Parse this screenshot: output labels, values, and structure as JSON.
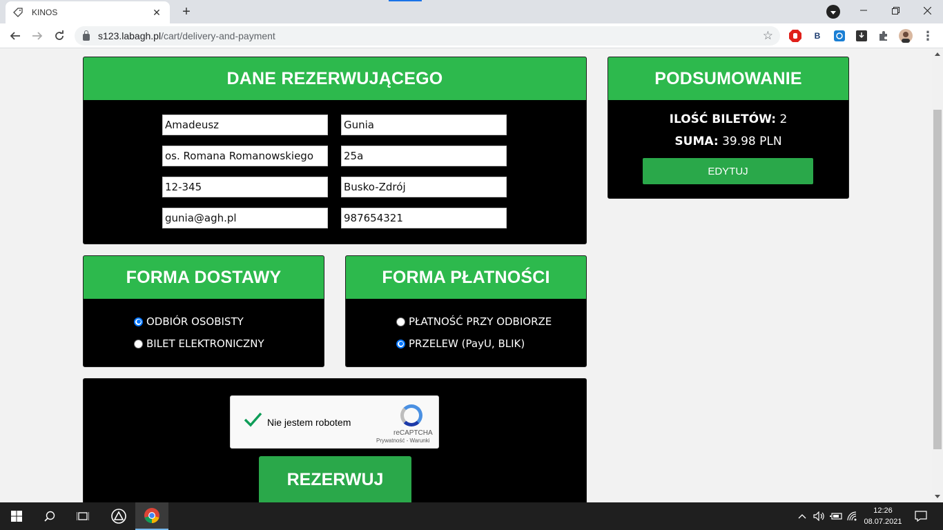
{
  "browser": {
    "tab_title": "KINOS",
    "url_host": "s123.labagh.pl",
    "url_path": "/cart/delivery-and-payment",
    "new_tab": "+",
    "close_tab": "✕"
  },
  "reservation": {
    "title": "DANE REZERWUJĄCEGO",
    "fields": {
      "first_name": "Amadeusz",
      "last_name": "Gunia",
      "street": "os. Romana Romanowskiego",
      "house_number": "25a",
      "postal_code": "12-345",
      "city": "Busko-Zdrój",
      "email": "gunia@agh.pl",
      "phone": "987654321"
    }
  },
  "delivery": {
    "title": "FORMA DOSTAWY",
    "options": [
      {
        "label": "ODBIÓR OSOBISTY",
        "selected": true
      },
      {
        "label": "BILET ELEKTRONICZNY",
        "selected": false
      }
    ]
  },
  "payment": {
    "title": "FORMA PŁATNOŚCI",
    "options": [
      {
        "label": "PŁATNOŚĆ PRZY ODBIORZE",
        "selected": false
      },
      {
        "label": "PRZELEW (PayU, BLIK)",
        "selected": true
      }
    ]
  },
  "summary": {
    "title": "PODSUMOWANIE",
    "tickets_label": "ILOŚĆ BILETÓW:",
    "tickets_value": "2",
    "sum_label": "SUMA:",
    "sum_value": "39.98 PLN",
    "edit_label": "EDYTUJ"
  },
  "captcha": {
    "label": "Nie jestem robotem",
    "brand": "reCAPTCHA",
    "links": "Prywatność - Warunki"
  },
  "reserve_label": "REZERWUJ",
  "taskbar": {
    "time": "12:26",
    "date": "08.07.2021"
  },
  "colors": {
    "header_green": "#2db94d",
    "button_green": "#2aa84a",
    "panel_bg": "#000000",
    "radio_accent": "#0075ff"
  }
}
